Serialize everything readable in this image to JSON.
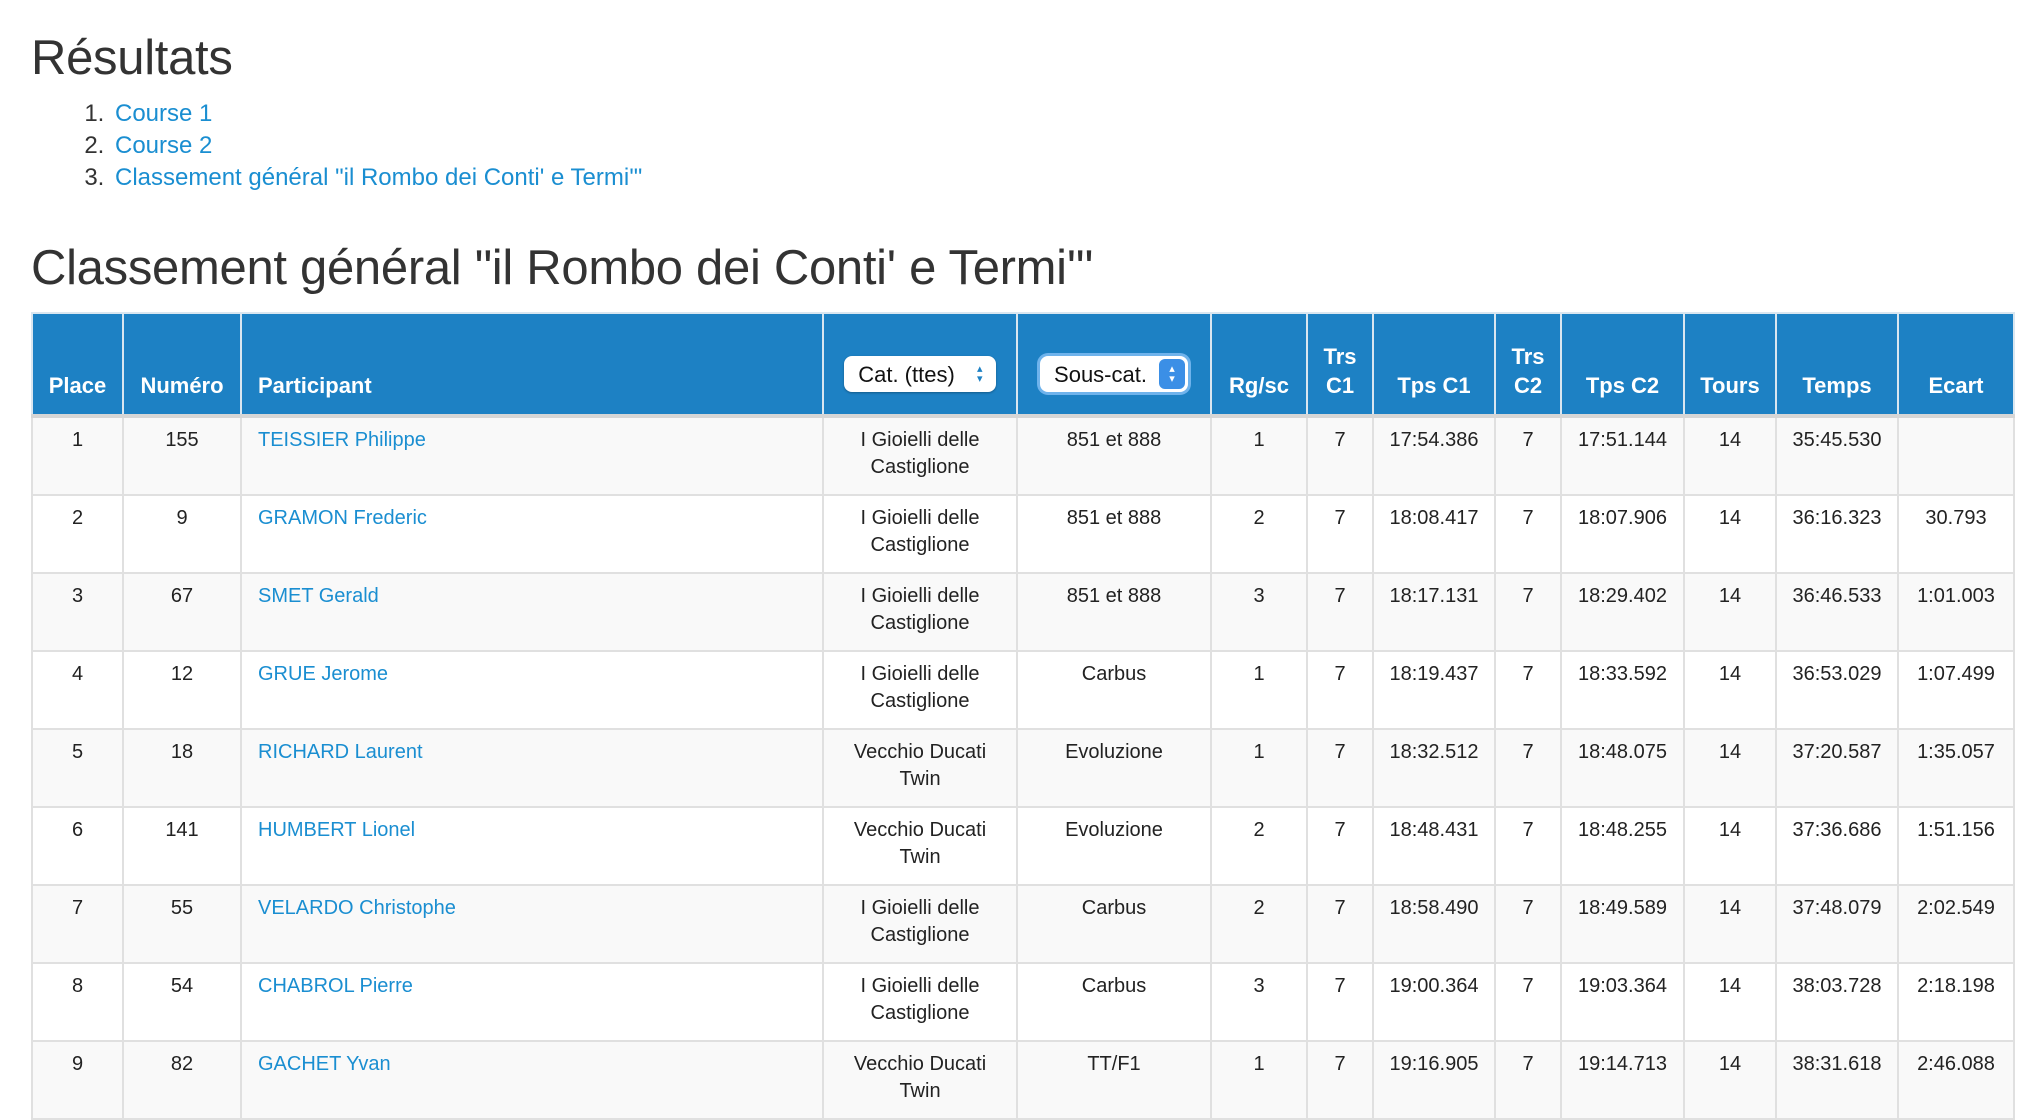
{
  "page": {
    "title": "Résultats",
    "toc": [
      {
        "label": "Course 1"
      },
      {
        "label": "Course 2"
      },
      {
        "label": "Classement général \"il Rombo dei Conti' e Termi'\""
      }
    ],
    "section_title": "Classement général \"il Rombo dei Conti' e Termi'\""
  },
  "table": {
    "headers": {
      "place": "Place",
      "numero": "Numéro",
      "participant": "Participant",
      "cat_select": "Cat. (ttes)",
      "souscat_select": "Sous-cat.",
      "rgsc": "Rg/sc",
      "trs_c1_a": "Trs",
      "trs_c1_b": "C1",
      "tps_c1": "Tps C1",
      "trs_c2_a": "Trs",
      "trs_c2_b": "C2",
      "tps_c2": "Tps C2",
      "tours": "Tours",
      "temps": "Temps",
      "ecart": "Ecart"
    },
    "rows": [
      {
        "place": "1",
        "numero": "155",
        "participant": "TEISSIER Philippe",
        "cat_a": "I Gioielli delle",
        "cat_b": "Castiglione",
        "souscat": "851 et 888",
        "rgsc": "1",
        "trs_c1": "7",
        "tps_c1": "17:54.386",
        "trs_c2": "7",
        "tps_c2": "17:51.144",
        "tours": "14",
        "temps": "35:45.530",
        "ecart": ""
      },
      {
        "place": "2",
        "numero": "9",
        "participant": "GRAMON Frederic",
        "cat_a": "I Gioielli delle",
        "cat_b": "Castiglione",
        "souscat": "851 et 888",
        "rgsc": "2",
        "trs_c1": "7",
        "tps_c1": "18:08.417",
        "trs_c2": "7",
        "tps_c2": "18:07.906",
        "tours": "14",
        "temps": "36:16.323",
        "ecart": "30.793"
      },
      {
        "place": "3",
        "numero": "67",
        "participant": "SMET Gerald",
        "cat_a": "I Gioielli delle",
        "cat_b": "Castiglione",
        "souscat": "851 et 888",
        "rgsc": "3",
        "trs_c1": "7",
        "tps_c1": "18:17.131",
        "trs_c2": "7",
        "tps_c2": "18:29.402",
        "tours": "14",
        "temps": "36:46.533",
        "ecart": "1:01.003"
      },
      {
        "place": "4",
        "numero": "12",
        "participant": "GRUE Jerome",
        "cat_a": "I Gioielli delle",
        "cat_b": "Castiglione",
        "souscat": "Carbus",
        "rgsc": "1",
        "trs_c1": "7",
        "tps_c1": "18:19.437",
        "trs_c2": "7",
        "tps_c2": "18:33.592",
        "tours": "14",
        "temps": "36:53.029",
        "ecart": "1:07.499"
      },
      {
        "place": "5",
        "numero": "18",
        "participant": "RICHARD Laurent",
        "cat_a": "Vecchio Ducati",
        "cat_b": "Twin",
        "souscat": "Evoluzione",
        "rgsc": "1",
        "trs_c1": "7",
        "tps_c1": "18:32.512",
        "trs_c2": "7",
        "tps_c2": "18:48.075",
        "tours": "14",
        "temps": "37:20.587",
        "ecart": "1:35.057"
      },
      {
        "place": "6",
        "numero": "141",
        "participant": "HUMBERT Lionel",
        "cat_a": "Vecchio Ducati",
        "cat_b": "Twin",
        "souscat": "Evoluzione",
        "rgsc": "2",
        "trs_c1": "7",
        "tps_c1": "18:48.431",
        "trs_c2": "7",
        "tps_c2": "18:48.255",
        "tours": "14",
        "temps": "37:36.686",
        "ecart": "1:51.156"
      },
      {
        "place": "7",
        "numero": "55",
        "participant": "VELARDO Christophe",
        "cat_a": "I Gioielli delle",
        "cat_b": "Castiglione",
        "souscat": "Carbus",
        "rgsc": "2",
        "trs_c1": "7",
        "tps_c1": "18:58.490",
        "trs_c2": "7",
        "tps_c2": "18:49.589",
        "tours": "14",
        "temps": "37:48.079",
        "ecart": "2:02.549"
      },
      {
        "place": "8",
        "numero": "54",
        "participant": "CHABROL Pierre",
        "cat_a": "I Gioielli delle",
        "cat_b": "Castiglione",
        "souscat": "Carbus",
        "rgsc": "3",
        "trs_c1": "7",
        "tps_c1": "19:00.364",
        "trs_c2": "7",
        "tps_c2": "19:03.364",
        "tours": "14",
        "temps": "38:03.728",
        "ecart": "2:18.198"
      },
      {
        "place": "9",
        "numero": "82",
        "participant": "GACHET Yvan",
        "cat_a": "Vecchio Ducati",
        "cat_b": "Twin",
        "souscat": "TT/F1",
        "rgsc": "1",
        "trs_c1": "7",
        "tps_c1": "19:16.905",
        "trs_c2": "7",
        "tps_c2": "19:14.713",
        "tours": "14",
        "temps": "38:31.618",
        "ecart": "2:46.088"
      }
    ]
  },
  "colors": {
    "header_bg": "#1d81c4",
    "link": "#1a8ed1",
    "stripe": "#f9f9f9"
  }
}
